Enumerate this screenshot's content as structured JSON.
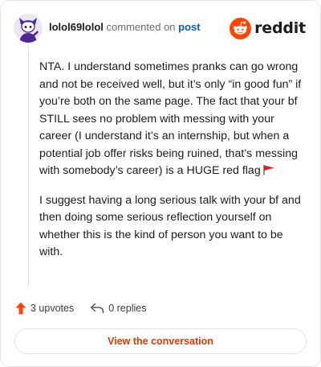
{
  "header": {
    "username": "lolol69lolol",
    "commented_text": "commented on",
    "post_link_label": "post",
    "brand_word": "reddit"
  },
  "comment": {
    "paragraphs": [
      "NTA. I understand sometimes pranks can go wrong and not be received well, but it’s only “in good fun” if you’re both on the same page. The fact that your bf STILL sees no problem with messing with your career (I understand it’s an internship, but when a potential job offer risks being ruined, that’s messing with somebody’s career) is a HUGE red flag",
      "I suggest having a long serious talk with your bf and then doing some serious reflection yourself on whether this is the kind of person you want to be with."
    ],
    "trailing_emoji": "red-flag-emoji"
  },
  "footer": {
    "upvotes_label": "3 upvotes",
    "replies_label": "0 replies",
    "view_conversation_label": "View the conversation"
  },
  "colors": {
    "brand_orange": "#ff4500",
    "link_blue": "#0a5bb5",
    "button_text": "#d93a00",
    "avatar_purple": "#4b2a8c"
  },
  "icons": {
    "avatar": "snoo-avatar-icon",
    "logo": "reddit-snoo-icon",
    "upvote": "upvote-arrow-icon",
    "reply": "reply-arrow-icon",
    "flag": "red-flag-icon"
  }
}
